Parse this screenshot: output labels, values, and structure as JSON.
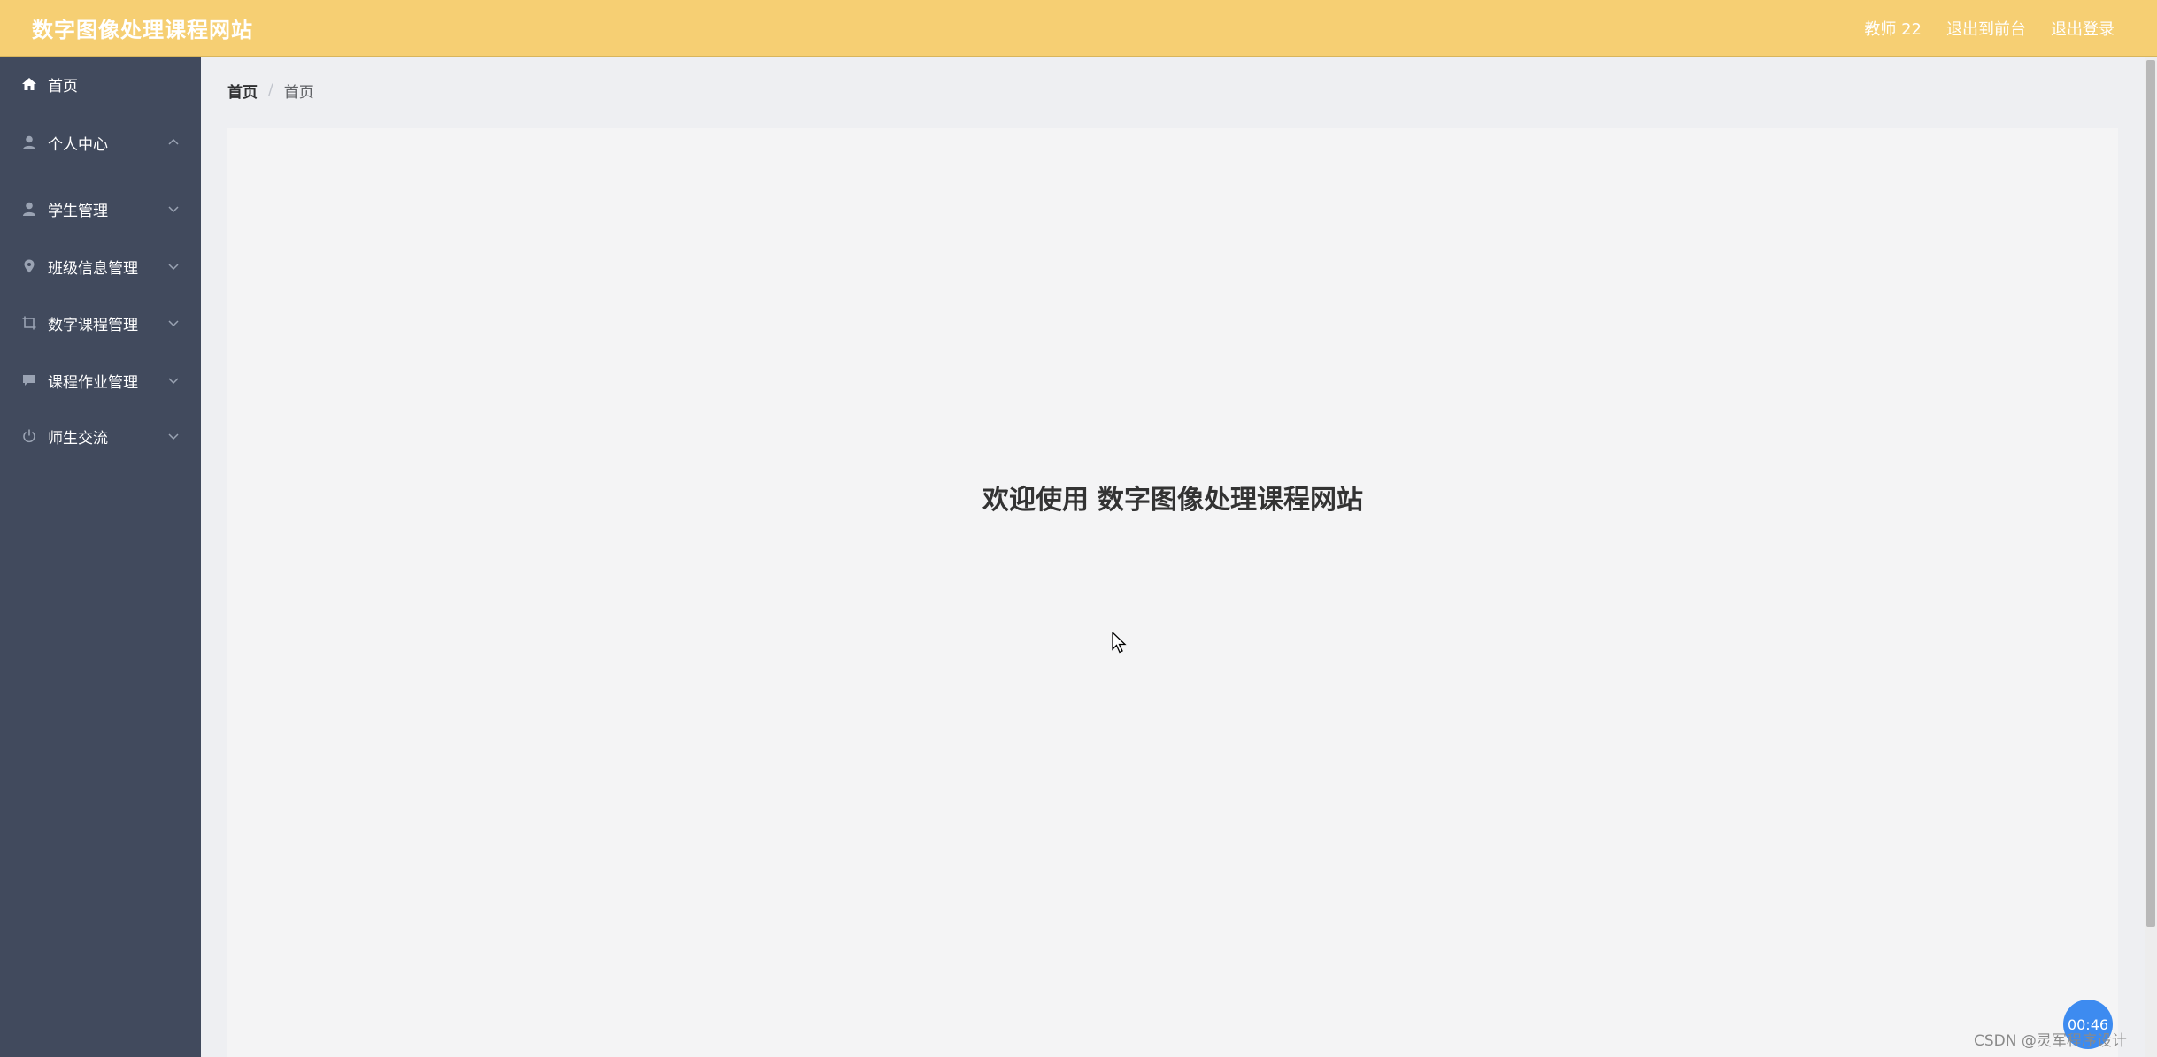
{
  "header": {
    "title": "数字图像处理课程网站",
    "user_label": "教师 22",
    "front_link": "退出到前台",
    "logout_link": "退出登录"
  },
  "sidebar": {
    "items": [
      {
        "label": "首页",
        "icon": "home-icon"
      },
      {
        "label": "个人中心",
        "icon": "user-icon"
      },
      {
        "label": "学生管理",
        "icon": "user-icon"
      },
      {
        "label": "班级信息管理",
        "icon": "location-icon"
      },
      {
        "label": "数字课程管理",
        "icon": "crop-icon"
      },
      {
        "label": "课程作业管理",
        "icon": "message-icon"
      },
      {
        "label": "师生交流",
        "icon": "power-icon"
      }
    ]
  },
  "breadcrumb": {
    "first": "首页",
    "separator": "/",
    "current": "首页"
  },
  "main": {
    "welcome_prefix": "欢迎使用",
    "welcome_app": "数字图像处理课程网站"
  },
  "overlay": {
    "timer": "00:46",
    "watermark": "CSDN @灵军程序设计"
  },
  "colors": {
    "header_bg": "#f6cf73",
    "sidebar_bg": "#414a5d",
    "content_bg": "#f4f4f5"
  }
}
